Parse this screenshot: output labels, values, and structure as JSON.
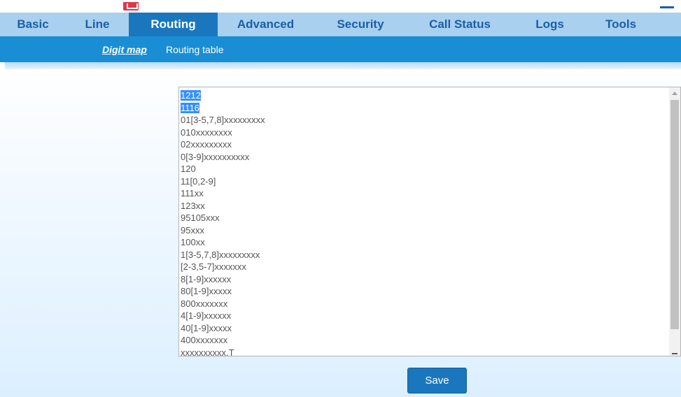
{
  "nav": {
    "items": [
      {
        "label": "Basic",
        "active": false
      },
      {
        "label": "Line",
        "active": false
      },
      {
        "label": "Routing",
        "active": true
      },
      {
        "label": "Advanced",
        "active": false
      },
      {
        "label": "Security",
        "active": false
      },
      {
        "label": "Call Status",
        "active": false
      },
      {
        "label": "Logs",
        "active": false
      },
      {
        "label": "Tools",
        "active": false
      }
    ]
  },
  "subnav": {
    "digit_map": "Digit map",
    "routing_table": "Routing table"
  },
  "digit_map": {
    "lines": [
      "1212",
      "1116",
      "01[3-5,7,8]xxxxxxxxx",
      "010xxxxxxxx",
      "02xxxxxxxxx",
      "0[3-9]xxxxxxxxxx",
      "120",
      "11[0,2-9]",
      "111xx",
      "123xx",
      "95105xxx",
      "95xxx",
      "100xx",
      "1[3-5,7,8]xxxxxxxxx",
      "[2-3,5-7]xxxxxxx",
      "8[1-9]xxxxxx",
      "80[1-9]xxxxx",
      "800xxxxxxx",
      "4[1-9]xxxxxx",
      "40[1-9]xxxxx",
      "400xxxxxxx",
      "xxxxxxxxxx.T"
    ],
    "selected_count": 2
  },
  "actions": {
    "save_label": "Save"
  },
  "colors": {
    "nav_bg": "#a9d0ef",
    "nav_active": "#1a77bd",
    "subnav_bg": "#1a8ed4",
    "selection": "#3390ff"
  }
}
